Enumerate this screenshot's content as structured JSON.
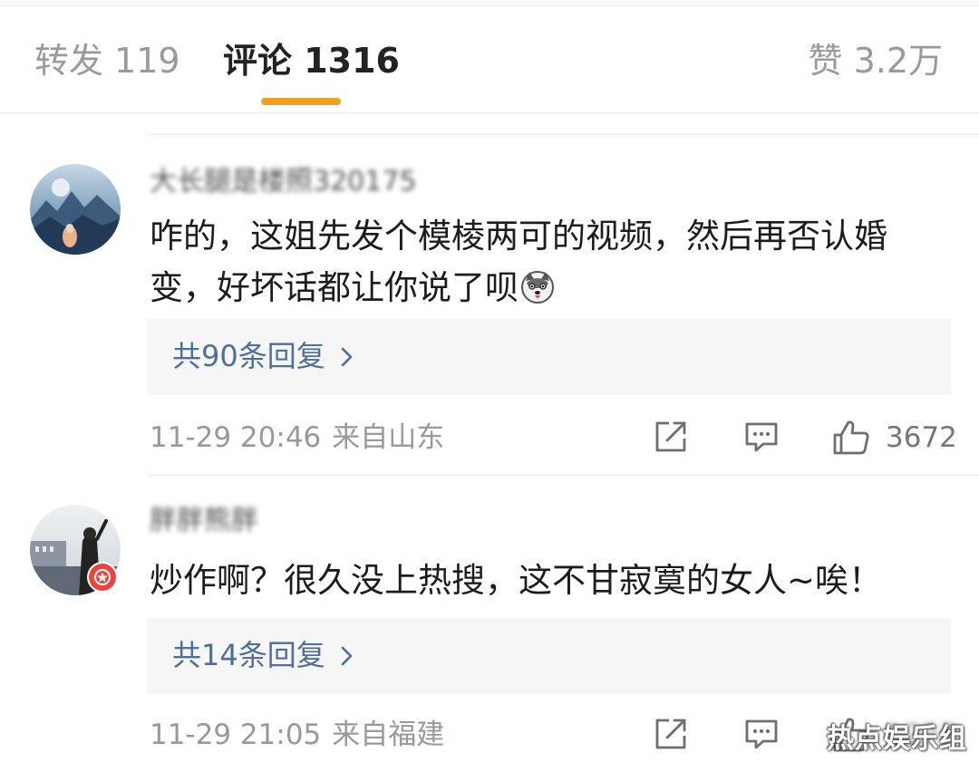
{
  "tabs": {
    "repost_label": "转发 119",
    "comments_label": "评论 1316",
    "likes_label": "赞 3.2万"
  },
  "colors": {
    "accent": "#f0a022",
    "link": "#4e6f9c",
    "meta": "#999999",
    "reply_bg": "#f6f6f6"
  },
  "comments": [
    {
      "username": "大长腿是楼照320175",
      "text": "咋的，这姐先发个模棱两可的视频，然后再否认婚变，好坏话都让你说了呗",
      "emoji": "husky-dog-emoji",
      "replies_label": "共90条回复",
      "time": "11-29 20:46",
      "location": "来自山东",
      "likes": "3672"
    },
    {
      "username": "胖胖熊胖",
      "text": "炒作啊？很久没上热搜，这不甘寂寞的女人~唉！",
      "replies_label": "共14条回复",
      "time": "11-29 21:05",
      "location": "来自福建",
      "likes": "1227"
    }
  ],
  "icons": {
    "share": "share-icon",
    "reply": "comment-icon",
    "like": "thumbs-up-icon",
    "chevron": "chevron-right-icon",
    "badge": "vip-star-badge-icon"
  },
  "watermark": "热点娱乐组"
}
